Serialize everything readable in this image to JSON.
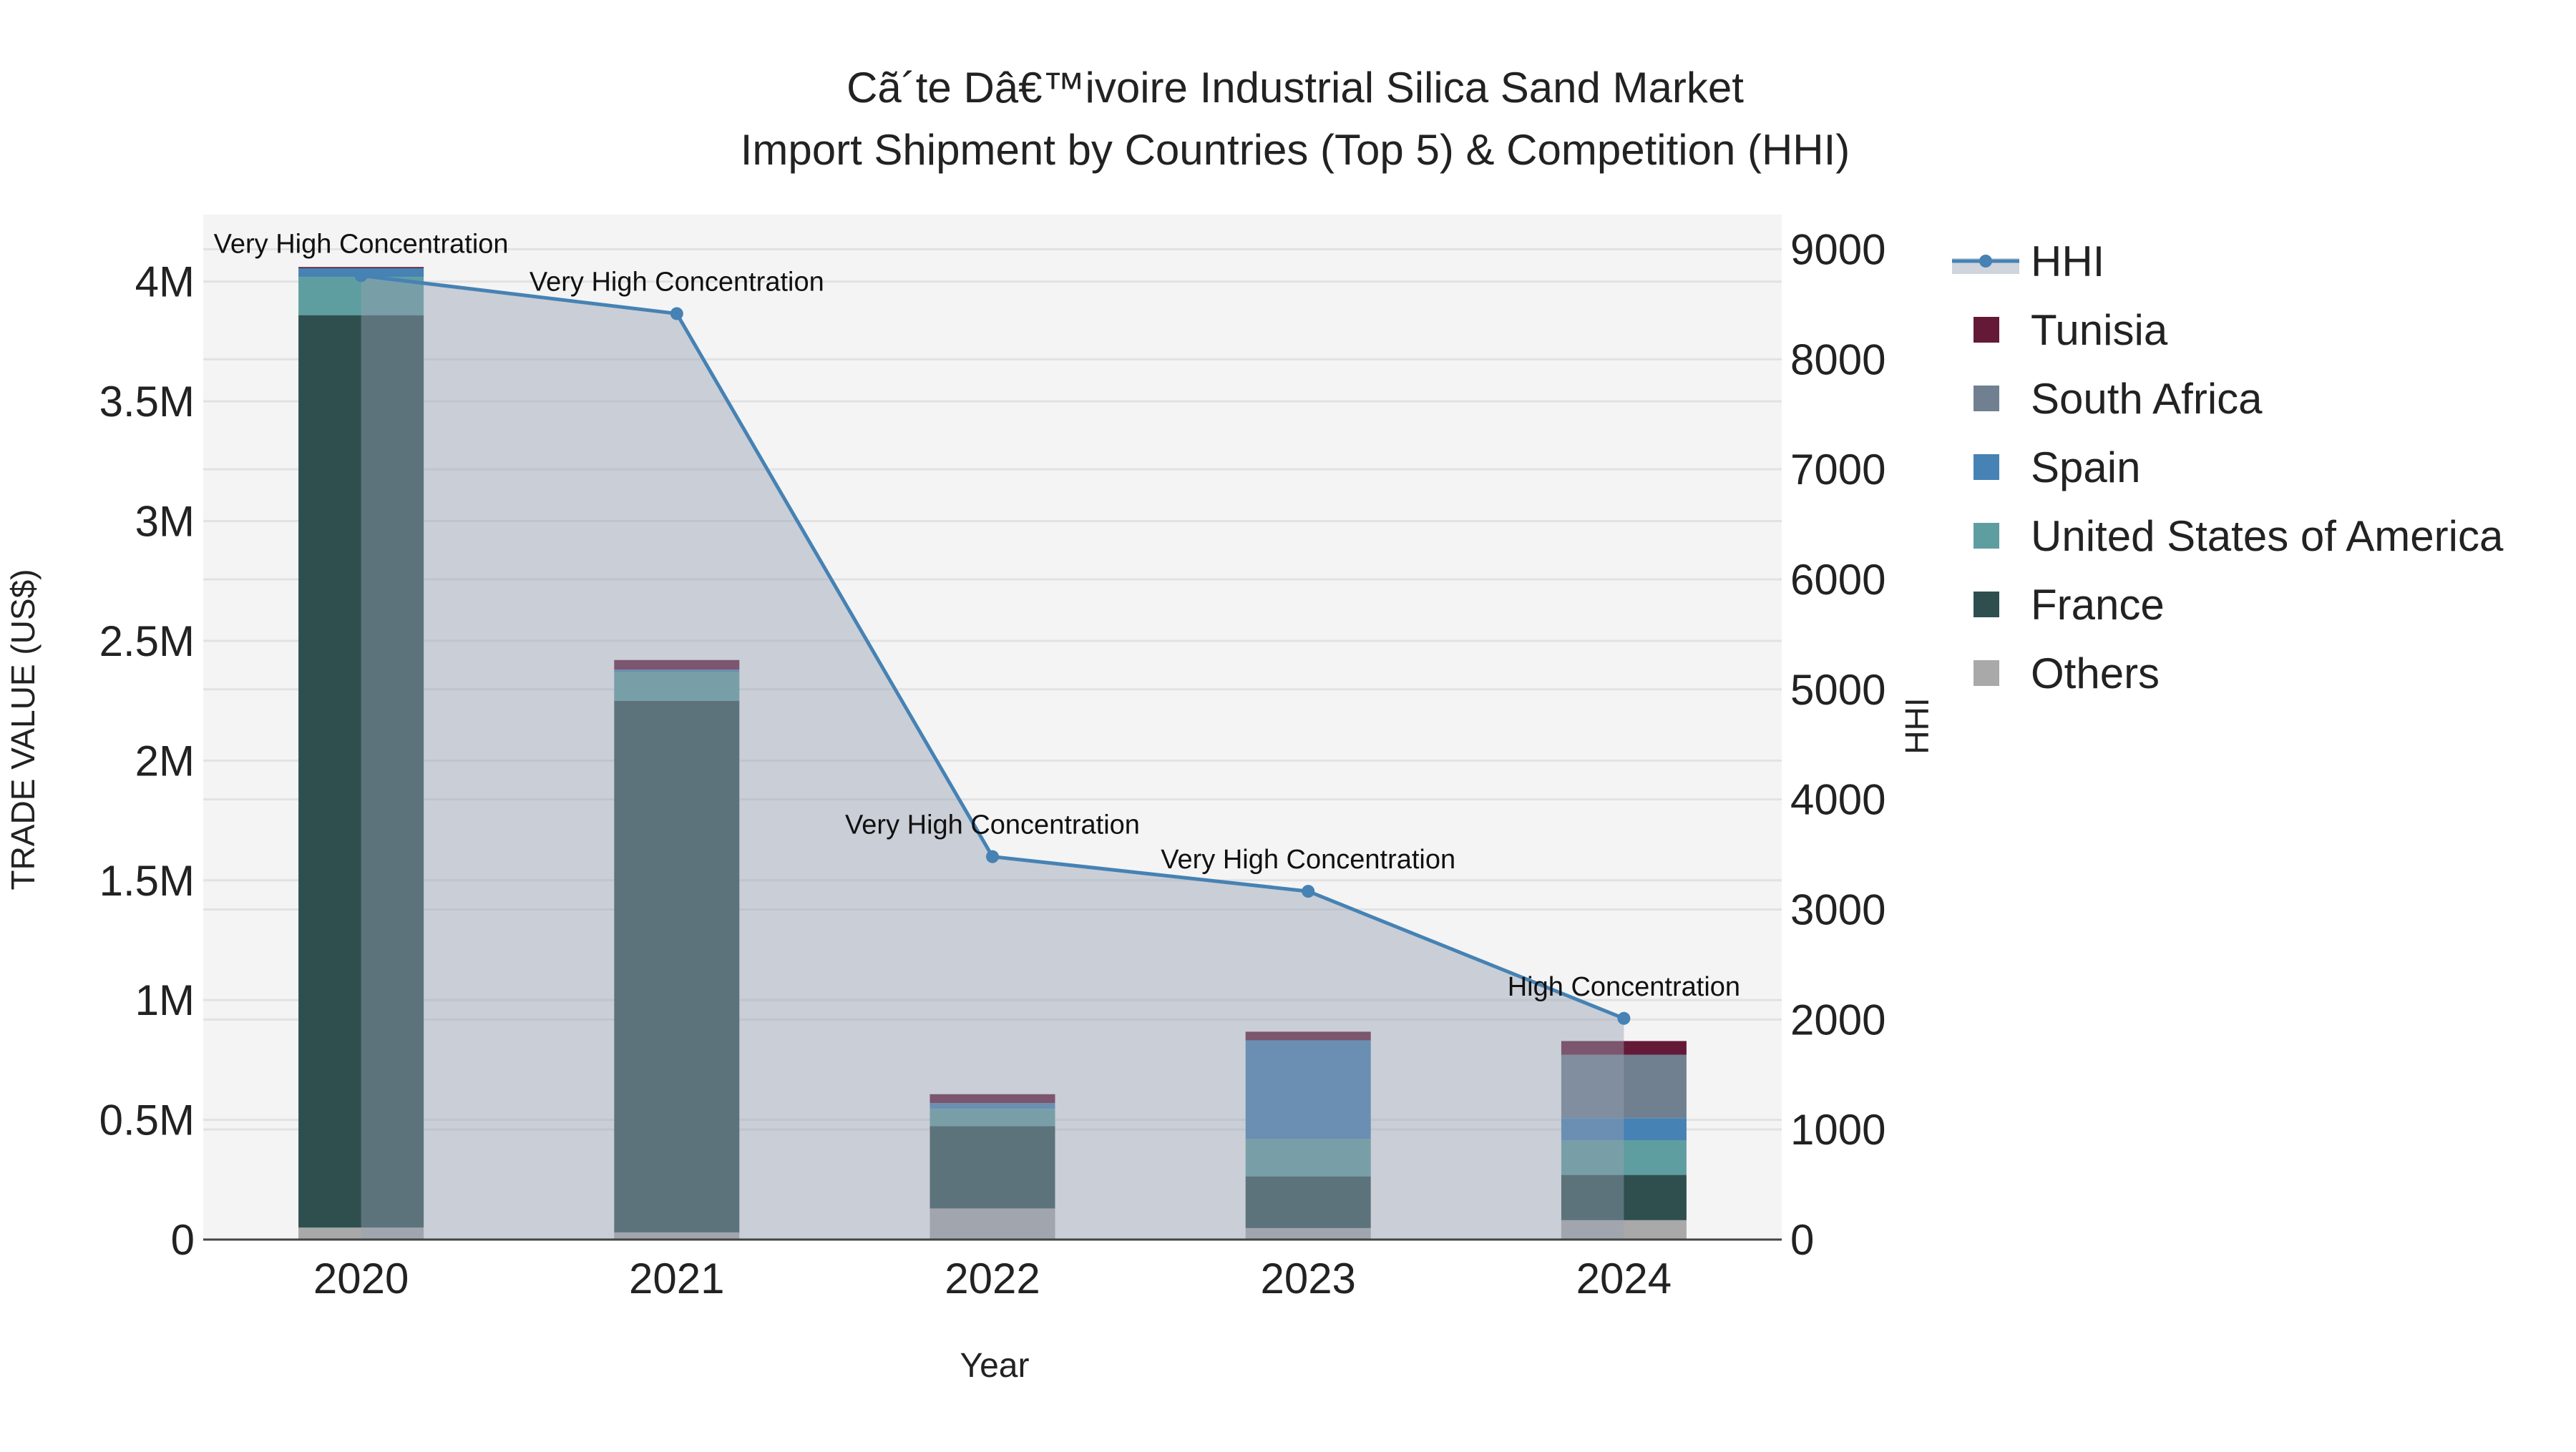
{
  "chart_data": {
    "type": "bar",
    "title_line1": "Cã´te Dâ€™ivoire Industrial Silica Sand Market",
    "title_line2": "Import Shipment by Countries (Top 5) & Competition (HHI)",
    "xlabel": "Year",
    "ylabel": "TRADE VALUE (US$)",
    "y2label": "HHI",
    "categories": [
      "2020",
      "2021",
      "2022",
      "2023",
      "2024"
    ],
    "ylim": [
      0,
      4280000
    ],
    "y2lim": [
      0,
      9315
    ],
    "yticks": [
      0,
      500000,
      1000000,
      1500000,
      2000000,
      2500000,
      3000000,
      3500000,
      4000000
    ],
    "ytick_labels": [
      "0",
      "0.5M",
      "1M",
      "1.5M",
      "2M",
      "2.5M",
      "3M",
      "3.5M",
      "4M"
    ],
    "y2ticks": [
      0,
      1000,
      2000,
      3000,
      4000,
      5000,
      6000,
      7000,
      8000,
      9000
    ],
    "y2tick_labels": [
      "0",
      "1000",
      "2000",
      "3000",
      "4000",
      "5000",
      "6000",
      "7000",
      "8000",
      "9000"
    ],
    "grid": true,
    "legend_placement": "right",
    "series": [
      {
        "name": "Others",
        "color": "#a9a9a9",
        "values": [
          50000,
          30000,
          130000,
          48000,
          81000
        ]
      },
      {
        "name": "France",
        "color": "#2f4f4f",
        "values": [
          3810000,
          2220000,
          344000,
          216000,
          189000
        ]
      },
      {
        "name": "United States of America",
        "color": "#5f9ea0",
        "values": [
          160000,
          120000,
          72000,
          156000,
          144000
        ]
      },
      {
        "name": "Spain",
        "color": "#4682b4",
        "values": [
          36000,
          10000,
          24000,
          412000,
          93000
        ]
      },
      {
        "name": "South Africa",
        "color": "#708090",
        "values": [
          0,
          0,
          0,
          0,
          265000
        ]
      },
      {
        "name": "Tunisia",
        "color": "#641a37",
        "values": [
          5000,
          40000,
          37000,
          36000,
          57000
        ]
      }
    ],
    "hhi": {
      "name": "HHI",
      "color": "#4682b4",
      "values": [
        8760,
        8415,
        3480,
        3165,
        2010
      ],
      "annotations": [
        "Very High Concentration",
        "Very High Concentration",
        "Very High Concentration",
        "Very High Concentration",
        "High Concentration"
      ]
    },
    "legend_order": [
      "HHI",
      "Tunisia",
      "South Africa",
      "Spain",
      "United States of America",
      "France",
      "Others"
    ]
  }
}
